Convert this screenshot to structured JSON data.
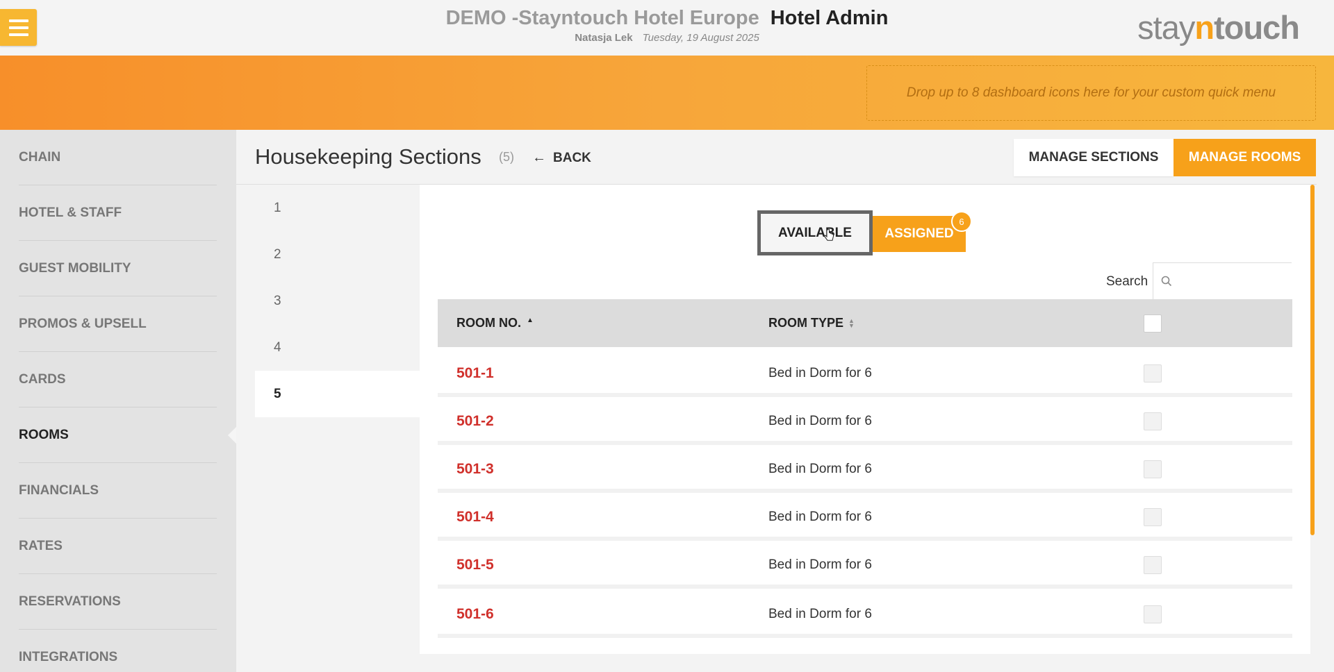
{
  "header": {
    "hotel_name": "DEMO -Stayntouch Hotel Europe",
    "app_name": "Hotel Admin",
    "user": "Natasja Lek",
    "date": "Tuesday, 19 August 2025",
    "logo": {
      "stay": "stay",
      "n": "n",
      "touch": "touch"
    }
  },
  "quickmenu": {
    "dropzone_text": "Drop up to 8 dashboard icons here for your custom quick menu"
  },
  "sidebar": {
    "items": [
      {
        "label": "CHAIN"
      },
      {
        "label": "HOTEL & STAFF"
      },
      {
        "label": "GUEST MOBILITY"
      },
      {
        "label": "PROMOS & UPSELL"
      },
      {
        "label": "CARDS"
      },
      {
        "label": "ROOMS"
      },
      {
        "label": "FINANCIALS"
      },
      {
        "label": "RATES"
      },
      {
        "label": "RESERVATIONS"
      },
      {
        "label": "INTEGRATIONS"
      }
    ],
    "active": "ROOMS"
  },
  "page": {
    "title": "Housekeeping Sections",
    "count": "(5)",
    "back_label": "BACK",
    "manage_sections_label": "MANAGE SECTIONS",
    "manage_rooms_label": "MANAGE ROOMS"
  },
  "sections": {
    "items": [
      "1",
      "2",
      "3",
      "4",
      "5"
    ],
    "active": "5"
  },
  "toggle": {
    "available_label": "AVAILABLE",
    "assigned_label": "ASSIGNED",
    "assigned_count": "6"
  },
  "search": {
    "label": "Search",
    "value": ""
  },
  "table": {
    "columns": [
      "ROOM NO.",
      "ROOM TYPE"
    ],
    "rows": [
      {
        "room_no": "501-1",
        "room_type": "Bed in Dorm for 6"
      },
      {
        "room_no": "501-2",
        "room_type": "Bed in Dorm for 6"
      },
      {
        "room_no": "501-3",
        "room_type": "Bed in Dorm for 6"
      },
      {
        "room_no": "501-4",
        "room_type": "Bed in Dorm for 6"
      },
      {
        "room_no": "501-5",
        "room_type": "Bed in Dorm for 6"
      },
      {
        "room_no": "501-6",
        "room_type": "Bed in Dorm for 6"
      }
    ]
  },
  "colors": {
    "accent": "#f7a11a",
    "room_link": "#d0302b",
    "menu_button": "#f7b731"
  }
}
